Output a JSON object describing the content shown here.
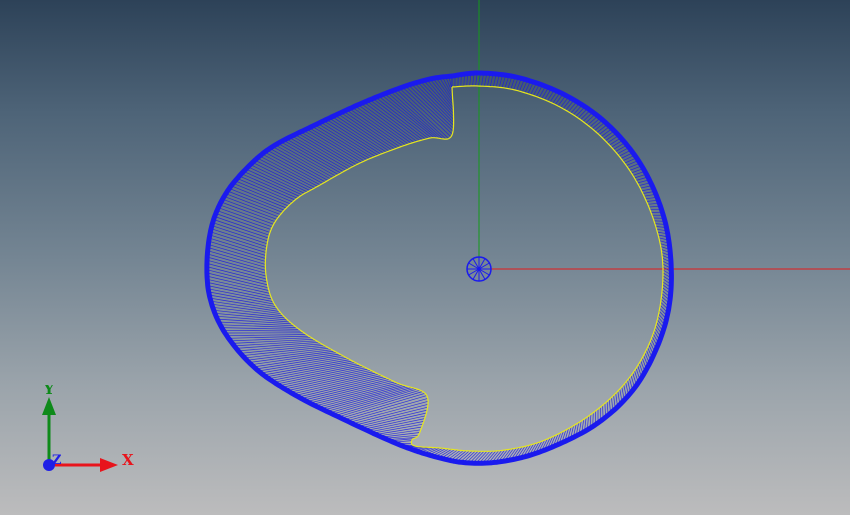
{
  "triad": {
    "x_label": "X",
    "y_label": "Y",
    "z_label": "Z",
    "x_color": "#e8141c",
    "y_color": "#0e8a1a",
    "z_color": "#1f1fe6"
  },
  "scene": {
    "part_outline_color": "#1a1aee",
    "hatch_color": "#1a1ae0",
    "inner_edge_color": "#e6e61e",
    "axis_x_color": "#e51a1a",
    "axis_y_color": "#149a1a",
    "center_marker_color": "#1a1aee"
  }
}
